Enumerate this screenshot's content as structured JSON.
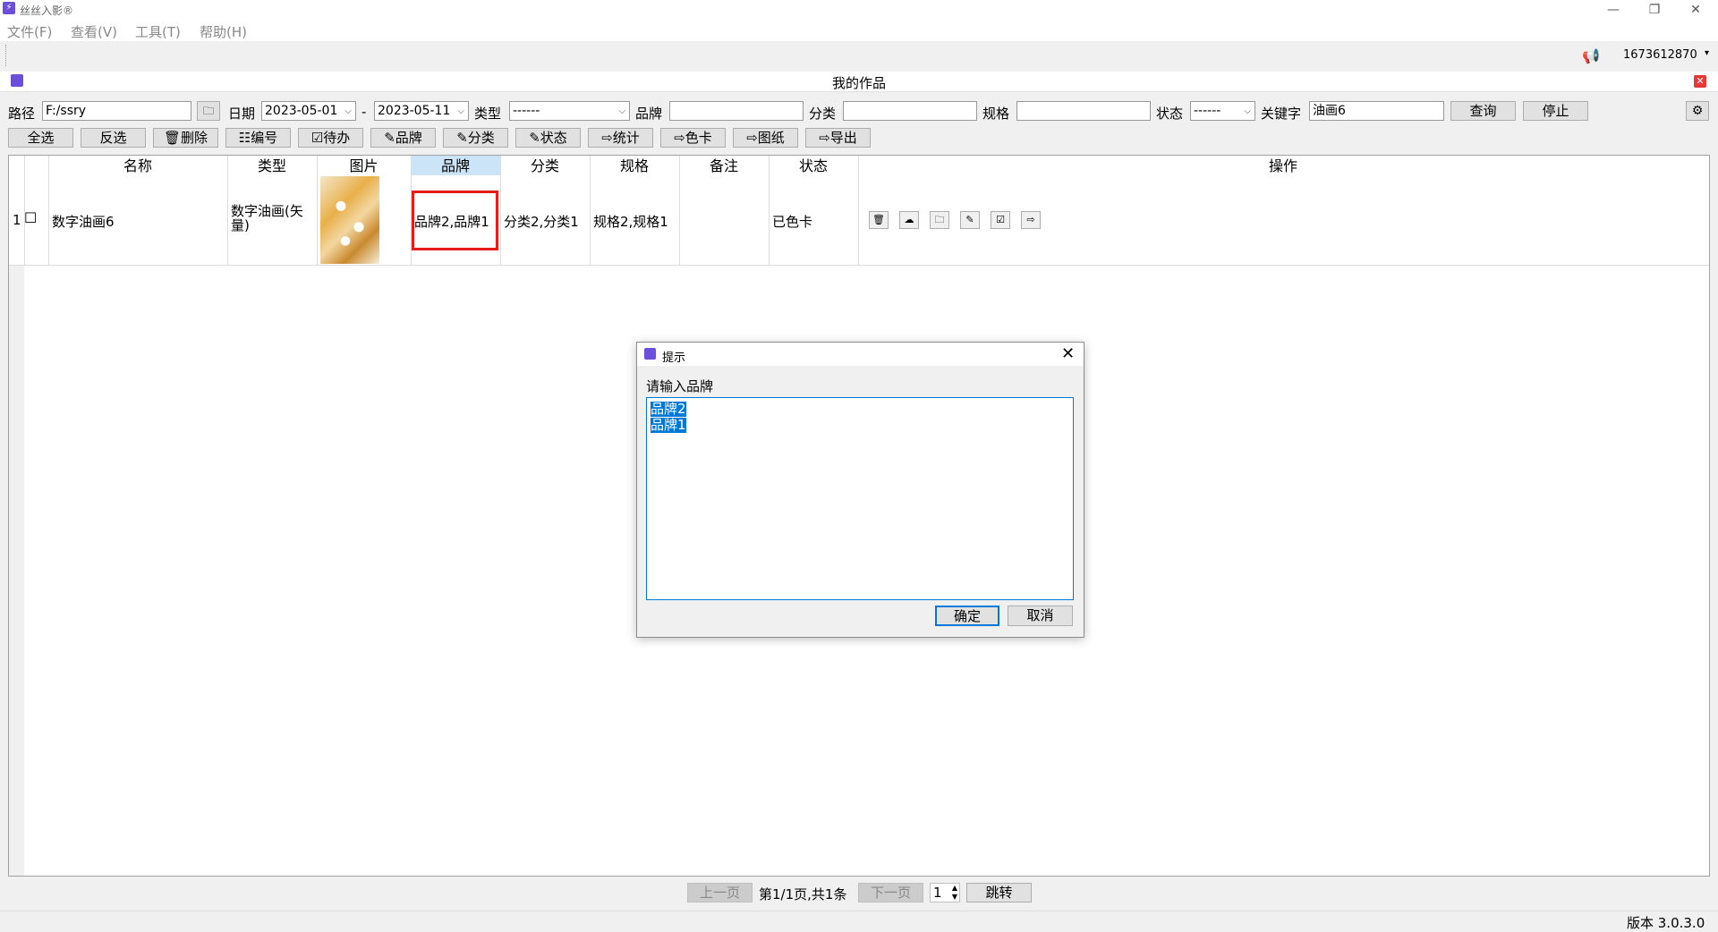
{
  "app": {
    "title": "丝丝入影®"
  },
  "window_controls": {
    "minimize": "—",
    "restore": "❐",
    "close": "✕"
  },
  "menu": [
    "文件(F)",
    "查看(V)",
    "工具(T)",
    "帮助(H)"
  ],
  "topstrip": {
    "user_id": "1673612870",
    "caret": "▾",
    "notice_icon": "📢"
  },
  "inner_window": {
    "title": "我的作品",
    "close": "✕"
  },
  "filters": {
    "path_label": "路径",
    "path_value": "F:/ssry",
    "folder_icon": "🗀",
    "date_label": "日期",
    "date_from": "2023-05-01",
    "date_sep": "-",
    "date_to": "2023-05-11",
    "type_label": "类型",
    "type_value": "------",
    "brand_label": "品牌",
    "brand_value": "",
    "category_label": "分类",
    "category_value": "",
    "spec_label": "规格",
    "spec_value": "",
    "status_label": "状态",
    "status_value": "------",
    "keyword_label": "关键字",
    "keyword_value": "油画6",
    "query_button": "查询",
    "stop_button": "停止",
    "settings_icon": "⚙"
  },
  "actions": {
    "select_all": "全选",
    "invert": "反选",
    "delete": "🗑删除",
    "number": "☷编号",
    "todo": "☑待办",
    "brand": "✎品牌",
    "category": "✎分类",
    "status": "✎状态",
    "stats": "⇨统计",
    "color_card": "⇨色卡",
    "drawing": "⇨图纸",
    "export": "⇨导出"
  },
  "table": {
    "headers": {
      "name": "名称",
      "type": "类型",
      "image": "图片",
      "brand": "品牌",
      "category": "分类",
      "spec": "规格",
      "remark": "备注",
      "status": "状态",
      "ops": "操作"
    },
    "rows": [
      {
        "index": "1",
        "checkbox": "☐",
        "name": "数字油画6",
        "type": "数字油画(矢量)",
        "brand": "品牌2,品牌1",
        "category": "分类2,分类1",
        "spec": "规格2,规格1",
        "remark": "",
        "status": "已色卡"
      }
    ],
    "op_icons": [
      "🗑",
      "☁",
      "🗀",
      "✎",
      "☑",
      "⇨"
    ]
  },
  "pagination": {
    "prev": "上一页",
    "info": "第1/1页,共1条",
    "next": "下一页",
    "page_value": "1",
    "jump": "跳转"
  },
  "status_bar": {
    "version": "版本 3.0.3.0"
  },
  "dialog": {
    "title": "提示",
    "close": "✕",
    "prompt": "请输入品牌",
    "lines": [
      "品牌2",
      "品牌1"
    ],
    "ok": "确定",
    "cancel": "取消"
  }
}
